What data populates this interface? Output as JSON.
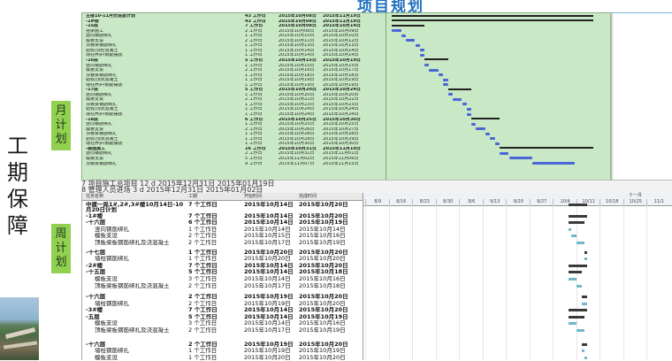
{
  "slide": {
    "title": "项目规划",
    "main_title": "工期保障",
    "tag_month": "月计划",
    "tag_week": "周计划"
  },
  "colors": {
    "title_blue": "#1f6fc1",
    "tag_green": "#92d050",
    "panel_green": "#c9e8c5",
    "bar_blue": "#4a66d8"
  },
  "monthly_plan": {
    "rows": [
      {
        "name": "主楼10-11月份进度计划",
        "dur": "43 工作日",
        "start": "2015年10月08日",
        "end": "2015年11月19日",
        "g": true
      },
      {
        "name": "-1#楼",
        "dur": "43 工作日",
        "start": "2015年10月08日",
        "end": "2015年11月19日",
        "g": true
      },
      {
        "name": "-15层",
        "dur": "7 工作日",
        "start": "2015年10月08日",
        "end": "2015年10月14日",
        "g": true
      },
      {
        "name": "搭架施工",
        "dur": "2 工作日",
        "start": "2015年10月08日",
        "end": "2015年10月09日"
      },
      {
        "name": "竖向钢筋绑扎",
        "dur": "1 工作日",
        "start": "2015年10月10日",
        "end": "2015年10月10日"
      },
      {
        "name": "模板支设",
        "dur": "2 工作日",
        "start": "2015年10月11日",
        "end": "2015年10月12日"
      },
      {
        "name": "顶板梁钢筋绑扎",
        "dur": "1 工作日",
        "start": "2015年10月13日",
        "end": "2015年10月13日"
      },
      {
        "name": "验收/浇砼混凝土",
        "dur": "1 工作日",
        "start": "2015年10月14日",
        "end": "2015年10月14日"
      },
      {
        "name": "墙柱养护/钢筋摆放",
        "dur": "1 工作日",
        "start": "2015年10月14日",
        "end": "2015年10月14日"
      },
      {
        "name": "-16层",
        "dur": "5 工作日",
        "start": "2015年10月15日",
        "end": "2015年10月19日",
        "g": true
      },
      {
        "name": "竖向钢筋绑扎",
        "dur": "1 工作日",
        "start": "2015年10月15日",
        "end": "2015年10月15日"
      },
      {
        "name": "模板支设",
        "dur": "2 工作日",
        "start": "2015年10月16日",
        "end": "2015年10月17日"
      },
      {
        "name": "顶板梁钢筋绑扎",
        "dur": "1 工作日",
        "start": "2015年10月18日",
        "end": "2015年10月18日"
      },
      {
        "name": "验收/浇筑混凝土",
        "dur": "1 工作日",
        "start": "2015年10月19日",
        "end": "2015年10月19日"
      },
      {
        "name": "墙柱养护/钢筋摆放",
        "dur": "1 工作日",
        "start": "2015年10月19日",
        "end": "2015年10月19日"
      },
      {
        "name": "-17层",
        "dur": "5 工作日",
        "start": "2015年10月20日",
        "end": "2015年10月24日",
        "g": true
      },
      {
        "name": "竖向钢筋绑扎",
        "dur": "1 工作日",
        "start": "2015年10月20日",
        "end": "2015年10月20日"
      },
      {
        "name": "模板支设",
        "dur": "2 工作日",
        "start": "2015年10月21日",
        "end": "2015年10月22日"
      },
      {
        "name": "顶板梁钢筋绑扎",
        "dur": "1 工作日",
        "start": "2015年10月23日",
        "end": "2015年10月23日"
      },
      {
        "name": "验收/浇筑混凝土",
        "dur": "1 工作日",
        "start": "2015年10月24日",
        "end": "2015年10月24日"
      },
      {
        "name": "墙柱养护/钢筋摆放",
        "dur": "1 工作日",
        "start": "2015年10月24日",
        "end": "2015年10月24日"
      },
      {
        "name": "-18层",
        "dur": "6 工作日",
        "start": "2015年10月25日",
        "end": "2015年10月30日",
        "g": true
      },
      {
        "name": "竖向钢筋绑扎",
        "dur": "1 工作日",
        "start": "2015年10月25日",
        "end": "2015年10月25日"
      },
      {
        "name": "模板支设",
        "dur": "2 工作日",
        "start": "2015年10月26日",
        "end": "2015年10月27日"
      },
      {
        "name": "顶板梁钢筋绑扎",
        "dur": "1 工作日",
        "start": "2015年10月28日",
        "end": "2015年10月28日"
      },
      {
        "name": "验收/浇筑混凝土",
        "dur": "1 工作日",
        "start": "2015年10月29日",
        "end": "2015年10月29日"
      },
      {
        "name": "墙柱养护/钢筋摆放",
        "dur": "1 工作日",
        "start": "2015年10月30日",
        "end": "2015年10月30日"
      },
      {
        "name": "-屋面施工",
        "dur": "16 工作日",
        "start": "2015年10月31日",
        "end": "2015年11月19日",
        "g": true
      },
      {
        "name": "竖向钢筋绑扎",
        "dur": "2 工作日",
        "start": "2015年10月31日",
        "end": "2015年11月01日"
      },
      {
        "name": "模板支设",
        "dur": "5 工作日",
        "start": "2015年11月02日",
        "end": "2015年11月06日"
      },
      {
        "name": "顶板梁钢筋绑扎",
        "dur": "9 工作日",
        "start": "2015年11月07日",
        "end": "2015年11月15日"
      }
    ]
  },
  "strip": {
    "row1": "7        项目施工总项目                         12 d        2015年12月31日   2015年01月19日",
    "row2": "8             管理人员进场                       3 d          2015年12月31日   2015年01月02日"
  },
  "weekly_plan": {
    "headers": {
      "name": "任务名称",
      "dur": "工期",
      "start": "开始时间",
      "end": "完成时间"
    },
    "months_label": "十一月",
    "week_cols": [
      "8/9",
      "8/16",
      "8/23",
      "8/30",
      "9/6",
      "9/13",
      "9/20",
      "9/27",
      "10/4",
      "10/11",
      "10/18",
      "10/25",
      "11/1"
    ],
    "rows": [
      {
        "name": "中建一局1#,2#,3#楼10月14日-10月20日计划",
        "dur": "7 个工作日",
        "start": "2015年10月14日",
        "end": "2015年10月20日",
        "b": true,
        "tall": true
      },
      {
        "name": "-1#楼",
        "dur": "7 个工作日",
        "start": "2015年10月14日",
        "end": "2015年10月20日",
        "b": true
      },
      {
        "name": "-十六层",
        "dur": "6 个工作日",
        "start": "2015年10月14日",
        "end": "2015年10月19日",
        "b": true
      },
      {
        "name": "竖向钢筋绑扎",
        "dur": "1 个工作日",
        "start": "2015年10月14日",
        "end": "2015年10月14日"
      },
      {
        "name": "模板支设",
        "dur": "2 个工作日",
        "start": "2015年10月15日",
        "end": "2015年10月16日"
      },
      {
        "name": "顶板梁板钢筋绑扎及浇混凝土",
        "dur": "2 个工作日",
        "start": "2015年10月17日",
        "end": "2015年10月19日"
      },
      {
        "name": "-十七层",
        "dur": "1 个工作日",
        "start": "2015年10月20日",
        "end": "2015年10月20日",
        "b": true,
        "gap": true
      },
      {
        "name": "墙柱钢筋绑扎",
        "dur": "1 个工作日",
        "start": "2015年10月20日",
        "end": "2015年10月20日"
      },
      {
        "name": "-2#楼",
        "dur": "7 个工作日",
        "start": "2015年10月14日",
        "end": "2015年10月20日",
        "b": true
      },
      {
        "name": "-十五层",
        "dur": "5 个工作日",
        "start": "2015年10月14日",
        "end": "2015年10月18日",
        "b": true
      },
      {
        "name": "模板支设",
        "dur": "3 个工作日",
        "start": "2015年10月14日",
        "end": "2015年10月16日"
      },
      {
        "name": "顶板梁板钢筋绑扎及浇混凝土",
        "dur": "2 个工作日",
        "start": "2015年10月17日",
        "end": "2015年10月18日",
        "tall": true
      },
      {
        "name": "-十六层",
        "dur": "2 个工作日",
        "start": "2015年10月19日",
        "end": "2015年10月20日",
        "b": true
      },
      {
        "name": "墙柱钢筋绑扎",
        "dur": "2 个工作日",
        "start": "2015年10月19日",
        "end": "2015年10月20日"
      },
      {
        "name": "-3#楼",
        "dur": "7 个工作日",
        "start": "2015年10月14日",
        "end": "2015年10月20日",
        "b": true
      },
      {
        "name": "-五层",
        "dur": "5 个工作日",
        "start": "2015年10月14日",
        "end": "2015年10月19日",
        "b": true
      },
      {
        "name": "模板支设",
        "dur": "3 个工作日",
        "start": "2015年10月14日",
        "end": "2015年10月16日"
      },
      {
        "name": "顶板梁板钢筋绑扎及浇混凝土",
        "dur": "2 个工作日",
        "start": "2015年10月17日",
        "end": "2015年10月19日",
        "tall": true
      },
      {
        "name": "-十六层",
        "dur": "2 个工作日",
        "start": "2015年10月19日",
        "end": "2015年10月20日",
        "b": true,
        "gap": true
      },
      {
        "name": "墙柱钢筋绑扎",
        "dur": "1 个工作日",
        "start": "2015年10月19日",
        "end": "2015年10月19日"
      },
      {
        "name": "模板支设",
        "dur": "1 个工作日",
        "start": "2015年10月20日",
        "end": "2015年10月20日"
      }
    ]
  }
}
